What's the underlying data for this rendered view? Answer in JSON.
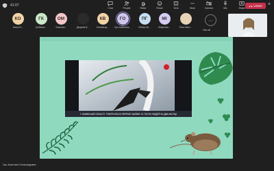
{
  "topbar": {
    "time": "41:07",
    "tools": [
      {
        "label": "Chat",
        "icon": "chat-icon"
      },
      {
        "label": "People",
        "icon": "people-icon"
      },
      {
        "label": "Raise",
        "icon": "raise-hand-icon"
      },
      {
        "label": "React",
        "icon": "react-icon"
      },
      {
        "label": "View",
        "icon": "view-icon"
      },
      {
        "label": "More",
        "icon": "more-icon"
      },
      {
        "label": "Camera",
        "icon": "camera-icon"
      },
      {
        "label": "Mic",
        "icon": "mic-icon"
      },
      {
        "label": "Share",
        "icon": "share-icon"
      }
    ],
    "leave_label": "Leave"
  },
  "participants": [
    {
      "initials": "КО",
      "name": "Ковш Ю...",
      "color": "#f1d3a7"
    },
    {
      "initials": "ГК",
      "name": "Гребенко...",
      "color": "#c9e7c9"
    },
    {
      "initials": "ОМ",
      "name": "Осипенко...",
      "color": "#f3c7c7"
    },
    {
      "initials": "",
      "name": "Дворник В...",
      "color": "#2b2b2b"
    },
    {
      "initials": "КВ",
      "name": "Коломієць...",
      "color": "#f1d3a7"
    },
    {
      "initials": "ГО",
      "name": "Гуш Анастасія...",
      "color": "#cfc6ee"
    },
    {
      "initials": "ПГ",
      "name": "Рибар Сві...",
      "color": "#c7dff3"
    },
    {
      "initials": "МІ",
      "name": "Марченко...",
      "color": "#d5cdf3"
    },
    {
      "initials": "",
      "name": "Пета Ната...",
      "color": "#e7d3b5"
    }
  ],
  "more": {
    "label": "View all"
  },
  "stage": {
    "caption": "У ЛЬВІВСЬКІЙ ОБЛАСТІ ТУБЕРКУЛЬОЗ ПЕРЕМІГ МАЙЖЕ 10 ТИСЯЧ ЛЮДЕЙ ЗА ДВА МІСЯЦІ",
    "colors": {
      "slide_bg": "#8fd9bf",
      "leaf": "#2f8a4e",
      "dark_leaf": "#1e5e3a"
    }
  },
  "presenter": "Гуш Анастасія Олександрівна"
}
